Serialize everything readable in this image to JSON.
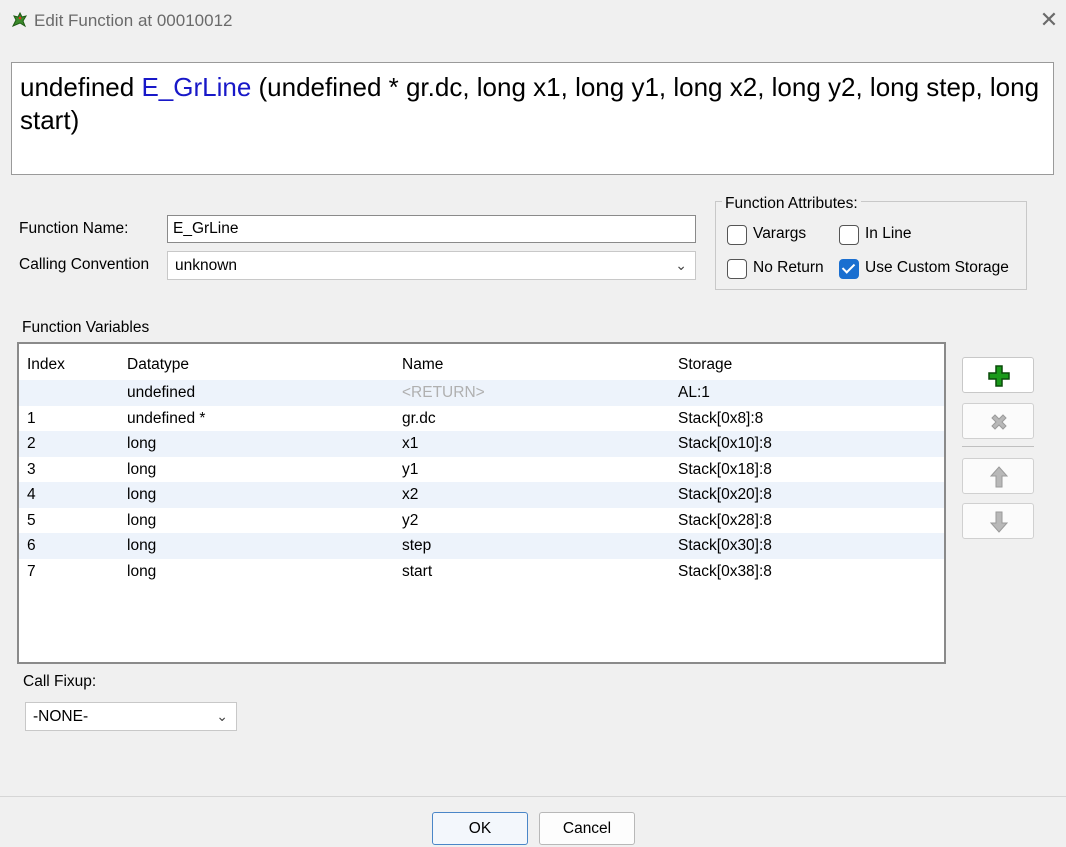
{
  "window": {
    "title": "Edit Function at 00010012",
    "close_glyph": "✕"
  },
  "signature": {
    "return_type": "undefined ",
    "function_name": "E_GrLine",
    "params": " (undefined * gr.dc, long x1, long y1, long x2, long y2, long step, long start)"
  },
  "form": {
    "function_name_label": "Function Name:",
    "function_name_value": "E_GrLine",
    "calling_convention_label": "Calling Convention",
    "calling_convention_value": "unknown"
  },
  "attributes": {
    "title": "Function Attributes:",
    "varargs": {
      "label": "Varargs",
      "checked": false
    },
    "in_line": {
      "label": "In Line",
      "checked": false
    },
    "no_return": {
      "label": "No Return",
      "checked": false
    },
    "custom_storage": {
      "label": "Use Custom Storage",
      "checked": true
    }
  },
  "variables": {
    "title": "Function Variables",
    "columns": [
      "Index",
      "Datatype",
      "Name",
      "Storage"
    ],
    "rows": [
      {
        "index": "",
        "datatype": "undefined",
        "name": "<RETURN>",
        "storage": "AL:1"
      },
      {
        "index": "1",
        "datatype": "undefined *",
        "name": "gr.dc",
        "storage": "Stack[0x8]:8"
      },
      {
        "index": "2",
        "datatype": "long",
        "name": "x1",
        "storage": "Stack[0x10]:8"
      },
      {
        "index": "3",
        "datatype": "long",
        "name": "y1",
        "storage": "Stack[0x18]:8"
      },
      {
        "index": "4",
        "datatype": "long",
        "name": "x2",
        "storage": "Stack[0x20]:8"
      },
      {
        "index": "5",
        "datatype": "long",
        "name": "y2",
        "storage": "Stack[0x28]:8"
      },
      {
        "index": "6",
        "datatype": "long",
        "name": "step",
        "storage": "Stack[0x30]:8"
      },
      {
        "index": "7",
        "datatype": "long",
        "name": "start",
        "storage": "Stack[0x38]:8"
      }
    ]
  },
  "side_buttons": [
    {
      "icon": "add-icon",
      "enabled": true
    },
    {
      "icon": "delete-icon",
      "enabled": false
    },
    {
      "icon": "move-up-icon",
      "enabled": false
    },
    {
      "icon": "move-down-icon",
      "enabled": false
    }
  ],
  "call_fixup": {
    "label": "Call Fixup:",
    "value": "-NONE-"
  },
  "buttons": {
    "ok": "OK",
    "cancel": "Cancel"
  },
  "colors": {
    "function_name": "#1818c8",
    "add_icon": "#1a9a1a",
    "checkbox_checked": "#1a6fd0"
  }
}
